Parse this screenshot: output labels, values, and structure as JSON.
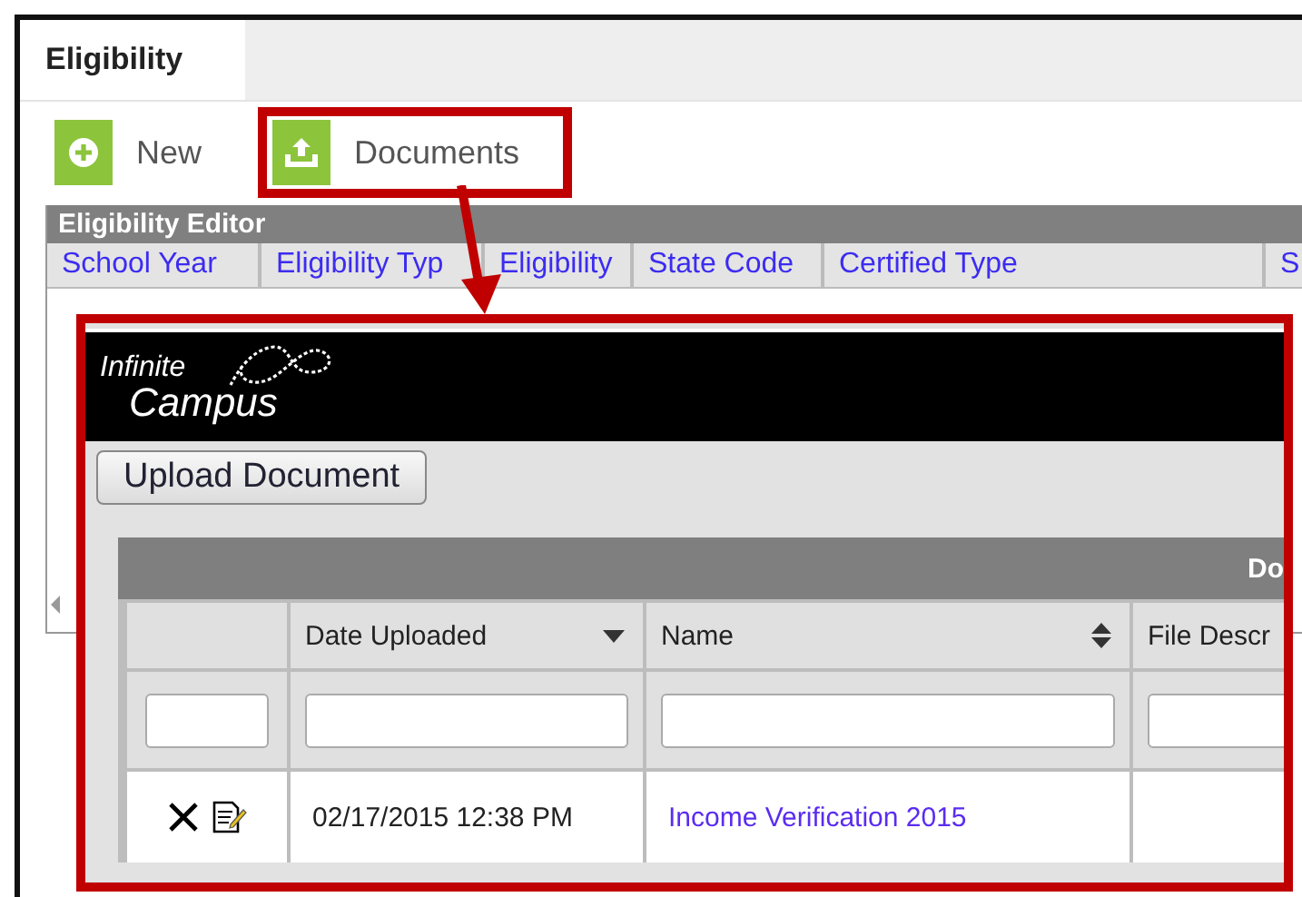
{
  "tabs": [
    {
      "label": "Eligibility",
      "selected": true
    }
  ],
  "toolbar": [
    {
      "label": "New",
      "kind": "add",
      "highlighted": false
    },
    {
      "label": "Documents",
      "kind": "upload",
      "highlighted": true
    }
  ],
  "editor": {
    "title": "Eligibility Editor",
    "columns": [
      "School Year",
      "Eligibility Typ",
      "Eligibility",
      "State Code",
      "Certified Type",
      "S"
    ]
  },
  "documents_popup": {
    "logo_line_1": "Infinite",
    "logo_line_2": "Campus",
    "upload_button": "Upload Document",
    "grid_title": "Do",
    "columns": [
      {
        "label": "Date Uploaded",
        "sorted_desc": true,
        "sortable": true
      },
      {
        "label": "Name",
        "sorted_desc": false,
        "sortable": true
      },
      {
        "label": "File Descr"
      }
    ],
    "rows": [
      {
        "date": "02/17/2015 12:38 PM",
        "name": "Income Verification 2015"
      }
    ]
  }
}
